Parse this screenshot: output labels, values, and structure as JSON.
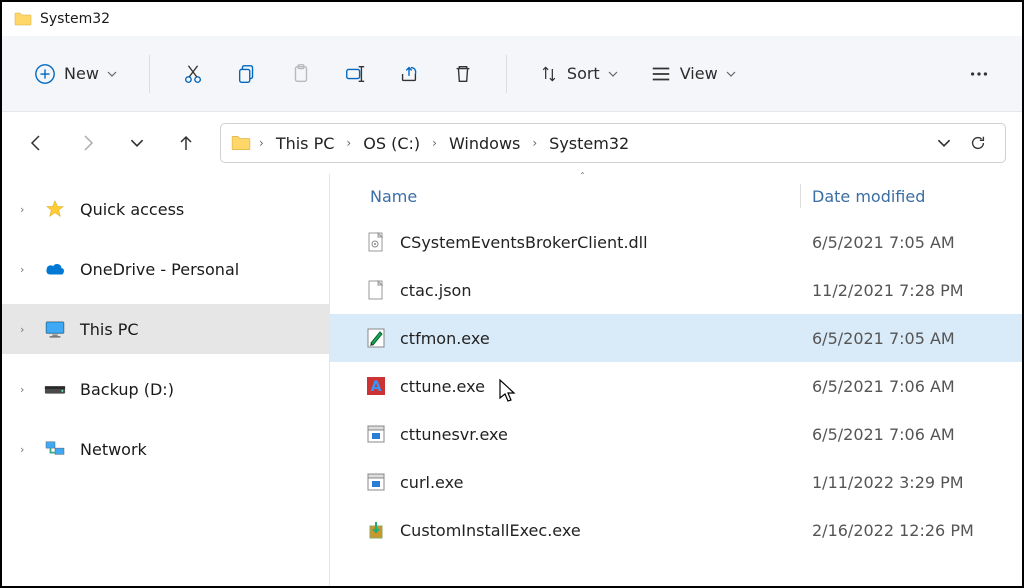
{
  "window": {
    "title": "System32"
  },
  "toolbar": {
    "new_label": "New",
    "sort_label": "Sort",
    "view_label": "View"
  },
  "breadcrumb": {
    "items": [
      "This PC",
      "OS (C:)",
      "Windows",
      "System32"
    ]
  },
  "columns": {
    "name": "Name",
    "date": "Date modified"
  },
  "sidebar": {
    "items": [
      {
        "label": "Quick access",
        "icon": "star"
      },
      {
        "label": "OneDrive - Personal",
        "icon": "cloud"
      },
      {
        "label": "This PC",
        "icon": "monitor",
        "selected": true
      },
      {
        "label": "Backup (D:)",
        "icon": "drive"
      },
      {
        "label": "Network",
        "icon": "network"
      }
    ]
  },
  "files": [
    {
      "name": "CSystemEventsBrokerClient.dll",
      "date": "6/5/2021 7:05 AM",
      "icon": "dll"
    },
    {
      "name": "ctac.json",
      "date": "11/2/2021 7:28 PM",
      "icon": "file"
    },
    {
      "name": "ctfmon.exe",
      "date": "6/5/2021 7:05 AM",
      "icon": "exe-pen",
      "selected": true
    },
    {
      "name": "cttune.exe",
      "date": "6/5/2021 7:06 AM",
      "icon": "exe-a"
    },
    {
      "name": "cttunesvr.exe",
      "date": "6/5/2021 7:06 AM",
      "icon": "exe"
    },
    {
      "name": "curl.exe",
      "date": "1/11/2022 3:29 PM",
      "icon": "exe"
    },
    {
      "name": "CustomInstallExec.exe",
      "date": "2/16/2022 12:26 PM",
      "icon": "exe-box"
    }
  ]
}
